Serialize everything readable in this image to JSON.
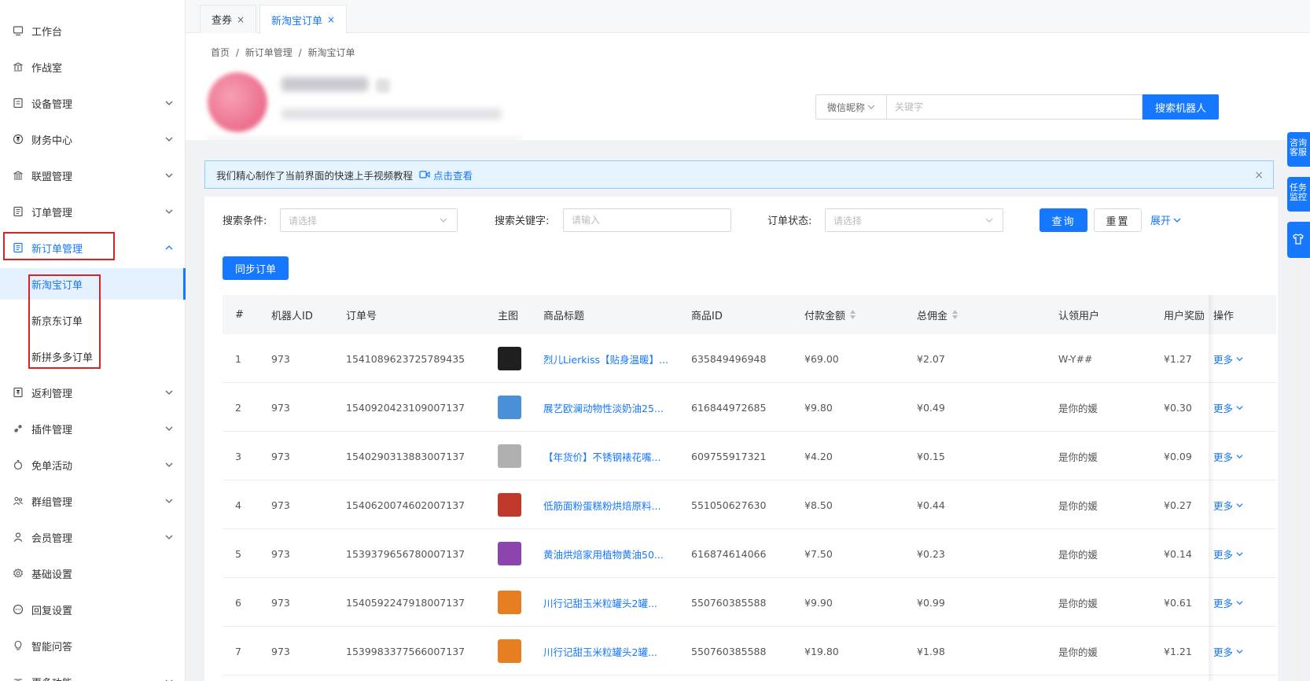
{
  "colors": {
    "primary": "#1677ff",
    "highlight_box": "#e02020"
  },
  "sidebar": {
    "items": [
      {
        "label": "工作台",
        "icon": "monitor-icon",
        "has_arrow": false
      },
      {
        "label": "作战室",
        "icon": "bank-icon",
        "has_arrow": false
      },
      {
        "label": "设备管理",
        "icon": "device-icon",
        "has_arrow": true
      },
      {
        "label": "财务中心",
        "icon": "yen-icon",
        "has_arrow": true
      },
      {
        "label": "联盟管理",
        "icon": "alliance-icon",
        "has_arrow": true
      },
      {
        "label": "订单管理",
        "icon": "order-icon",
        "has_arrow": true
      },
      {
        "label": "新订单管理",
        "icon": "order-icon",
        "has_arrow": true,
        "expanded": true
      },
      {
        "label": "返利管理",
        "icon": "rebate-icon",
        "has_arrow": true
      },
      {
        "label": "插件管理",
        "icon": "plugin-icon",
        "has_arrow": true
      },
      {
        "label": "免单活动",
        "icon": "activity-icon",
        "has_arrow": true
      },
      {
        "label": "群组管理",
        "icon": "group-icon",
        "has_arrow": true
      },
      {
        "label": "会员管理",
        "icon": "user-icon",
        "has_arrow": true
      },
      {
        "label": "基础设置",
        "icon": "gear-icon",
        "has_arrow": false
      },
      {
        "label": "回复设置",
        "icon": "chat-icon",
        "has_arrow": false
      },
      {
        "label": "智能问答",
        "icon": "bulb-icon",
        "has_arrow": false
      },
      {
        "label": "更多功能",
        "icon": "more-icon",
        "has_arrow": true
      }
    ],
    "sub_items": [
      {
        "label": "新淘宝订单",
        "active": true
      },
      {
        "label": "新京东订单",
        "active": false
      },
      {
        "label": "新拼多多订单",
        "active": false
      }
    ]
  },
  "tabs": [
    {
      "label": "查券",
      "active": false
    },
    {
      "label": "新淘宝订单",
      "active": true
    }
  ],
  "breadcrumb": [
    "首页",
    "/",
    "新订单管理",
    "/",
    "新淘宝订单"
  ],
  "robot_search": {
    "select_value": "微信昵称",
    "placeholder": "关键字",
    "button": "搜索机器人"
  },
  "notice": {
    "text": "我们精心制作了当前界面的快速上手视频教程",
    "link": "点击查看",
    "close": "×"
  },
  "filters": {
    "condition_label": "搜索条件:",
    "condition_placeholder": "请选择",
    "keyword_label": "搜索关键字:",
    "keyword_placeholder": "请输入",
    "status_label": "订单状态:",
    "status_placeholder": "请选择",
    "query_btn": "查询",
    "reset_btn": "重置",
    "expand": "展开",
    "sync_btn": "同步订单"
  },
  "table": {
    "columns": [
      "#",
      "机器人ID",
      "订单号",
      "主图",
      "商品标题",
      "商品ID",
      "付款金额",
      "总佣金",
      "认领用户",
      "用户奖励",
      "操作"
    ],
    "more_label": "更多",
    "rows": [
      {
        "idx": "1",
        "robot_id": "973",
        "order_no": "1541089623725789435",
        "thumb": "#1f1f1f",
        "title": "烈儿Lierkiss【贴身温暖】...",
        "item_id": "635849496948",
        "pay": "¥69.00",
        "commission": "¥2.07",
        "user": "W-Y##",
        "reward": "¥1.27"
      },
      {
        "idx": "2",
        "robot_id": "973",
        "order_no": "1540920423109007137",
        "thumb": "#4a90d9",
        "title": "展艺欧澜动物性淡奶油25...",
        "item_id": "616844972685",
        "pay": "¥9.80",
        "commission": "¥0.49",
        "user": "是你的媛",
        "reward": "¥0.30"
      },
      {
        "idx": "3",
        "robot_id": "973",
        "order_no": "1540290313883007137",
        "thumb": "#b0b0b0",
        "title": "【年货价】不锈钢裱花嘴...",
        "item_id": "609755917321",
        "pay": "¥4.20",
        "commission": "¥0.15",
        "user": "是你的媛",
        "reward": "¥0.09"
      },
      {
        "idx": "4",
        "robot_id": "973",
        "order_no": "1540620074602007137",
        "thumb": "#c0392b",
        "title": "低筋面粉蛋糕粉烘焙原料...",
        "item_id": "551050627630",
        "pay": "¥8.50",
        "commission": "¥0.44",
        "user": "是你的媛",
        "reward": "¥0.27"
      },
      {
        "idx": "5",
        "robot_id": "973",
        "order_no": "1539379656780007137",
        "thumb": "#8e44ad",
        "title": "黄油烘焙家用植物黄油50...",
        "item_id": "616874614066",
        "pay": "¥7.50",
        "commission": "¥0.23",
        "user": "是你的媛",
        "reward": "¥0.14"
      },
      {
        "idx": "6",
        "robot_id": "973",
        "order_no": "1540592247918007137",
        "thumb": "#e67e22",
        "title": "川行记甜玉米粒罐头2罐...",
        "item_id": "550760385588",
        "pay": "¥9.90",
        "commission": "¥0.99",
        "user": "是你的媛",
        "reward": "¥0.61"
      },
      {
        "idx": "7",
        "robot_id": "973",
        "order_no": "1539983377566007137",
        "thumb": "#e67e22",
        "title": "川行记甜玉米粒罐头2罐...",
        "item_id": "550760385588",
        "pay": "¥19.80",
        "commission": "¥1.98",
        "user": "是你的媛",
        "reward": "¥1.21"
      }
    ]
  },
  "floating": [
    {
      "label": "咨询客服"
    },
    {
      "label": "任务监控"
    }
  ]
}
